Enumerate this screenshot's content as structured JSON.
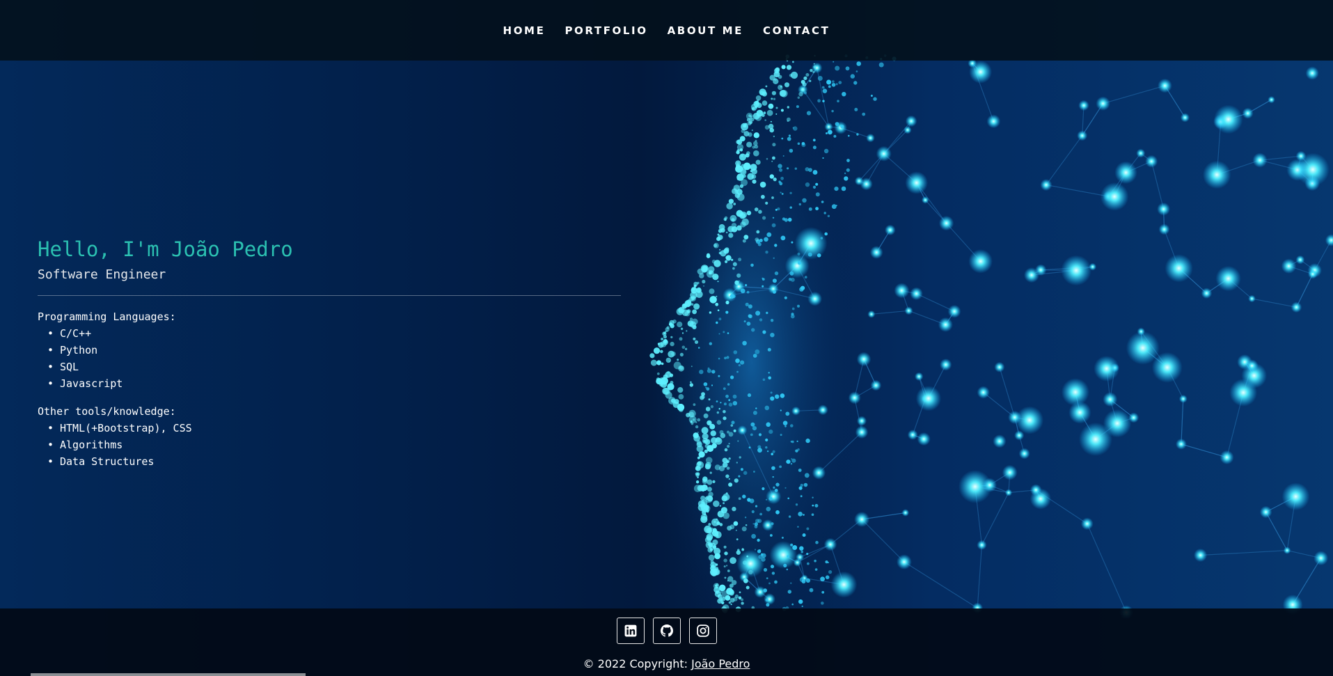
{
  "nav": {
    "items": [
      {
        "label": "HOME"
      },
      {
        "label": "PORTFOLIO"
      },
      {
        "label": "ABOUT ME"
      },
      {
        "label": "CONTACT"
      }
    ]
  },
  "hero": {
    "title": "Hello, I'm João Pedro",
    "subtitle": "Software Engineer",
    "programming_heading": "Programming Languages:",
    "programming_items": [
      "C/C++",
      "Python",
      "SQL",
      "Javascript"
    ],
    "tools_heading": "Other tools/knowledge:",
    "tools_items": [
      "HTML(+Bootstrap), CSS",
      "Algorithms",
      "Data Structures"
    ]
  },
  "footer": {
    "social": [
      {
        "name": "linkedin-icon"
      },
      {
        "name": "github-icon"
      },
      {
        "name": "instagram-icon"
      }
    ],
    "copyright_prefix": "© 2022 Copyright: ",
    "copyright_name": "João Pedro"
  },
  "colors": {
    "accent": "#2bc0b1",
    "background": "#021634",
    "glow": "#2fe3ff"
  }
}
